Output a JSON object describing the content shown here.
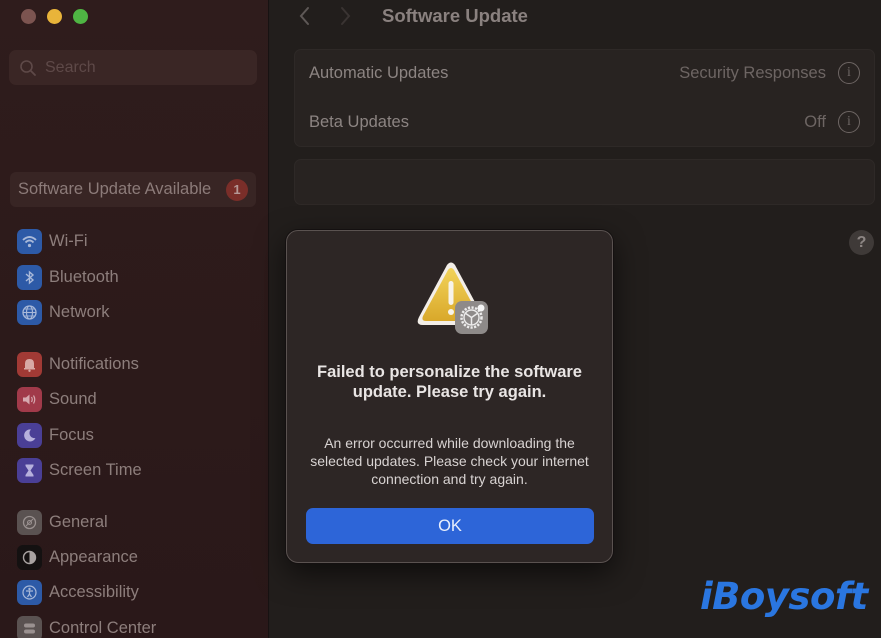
{
  "window": {
    "traffic_lights": [
      "close",
      "minimize",
      "zoom"
    ]
  },
  "sidebar": {
    "search": {
      "placeholder": "Search",
      "value": ""
    },
    "update_item": {
      "label": "Software Update Available",
      "badge": "1"
    },
    "items": [
      {
        "label": "Wi-Fi",
        "icon": "wifi-icon",
        "color": "#2d5aa7"
      },
      {
        "label": "Bluetooth",
        "icon": "bluetooth-icon",
        "color": "#2d5aa7"
      },
      {
        "label": "Network",
        "icon": "globe-icon",
        "color": "#2d5aa7"
      },
      {
        "label": "Notifications",
        "icon": "bell-icon",
        "color": "#a13a35"
      },
      {
        "label": "Sound",
        "icon": "speaker-icon",
        "color": "#a13a4a"
      },
      {
        "label": "Focus",
        "icon": "moon-icon",
        "color": "#4a3f96"
      },
      {
        "label": "Screen Time",
        "icon": "hourglass-icon",
        "color": "#4a3f96"
      },
      {
        "label": "General",
        "icon": "gear-icon",
        "color": "#5a5251"
      },
      {
        "label": "Appearance",
        "icon": "appearance-icon",
        "color": "#141111"
      },
      {
        "label": "Accessibility",
        "icon": "accessibility-icon",
        "color": "#2d5aa7"
      },
      {
        "label": "Control Center",
        "icon": "control-center-icon",
        "color": "#5a5251"
      }
    ]
  },
  "main": {
    "title": "Software Update",
    "rows": [
      {
        "label": "Automatic Updates",
        "value": "Security Responses"
      },
      {
        "label": "Beta Updates",
        "value": "Off"
      }
    ],
    "help_label": "?"
  },
  "dialog": {
    "title": "Failed to personalize the software update. Please try again.",
    "message": "An error occurred while downloading the selected updates. Please check your internet connection and try again.",
    "ok_label": "OK",
    "accent": "#2d65d8"
  },
  "watermark": {
    "text": "iBoysoft",
    "color": "#2a76e0"
  }
}
